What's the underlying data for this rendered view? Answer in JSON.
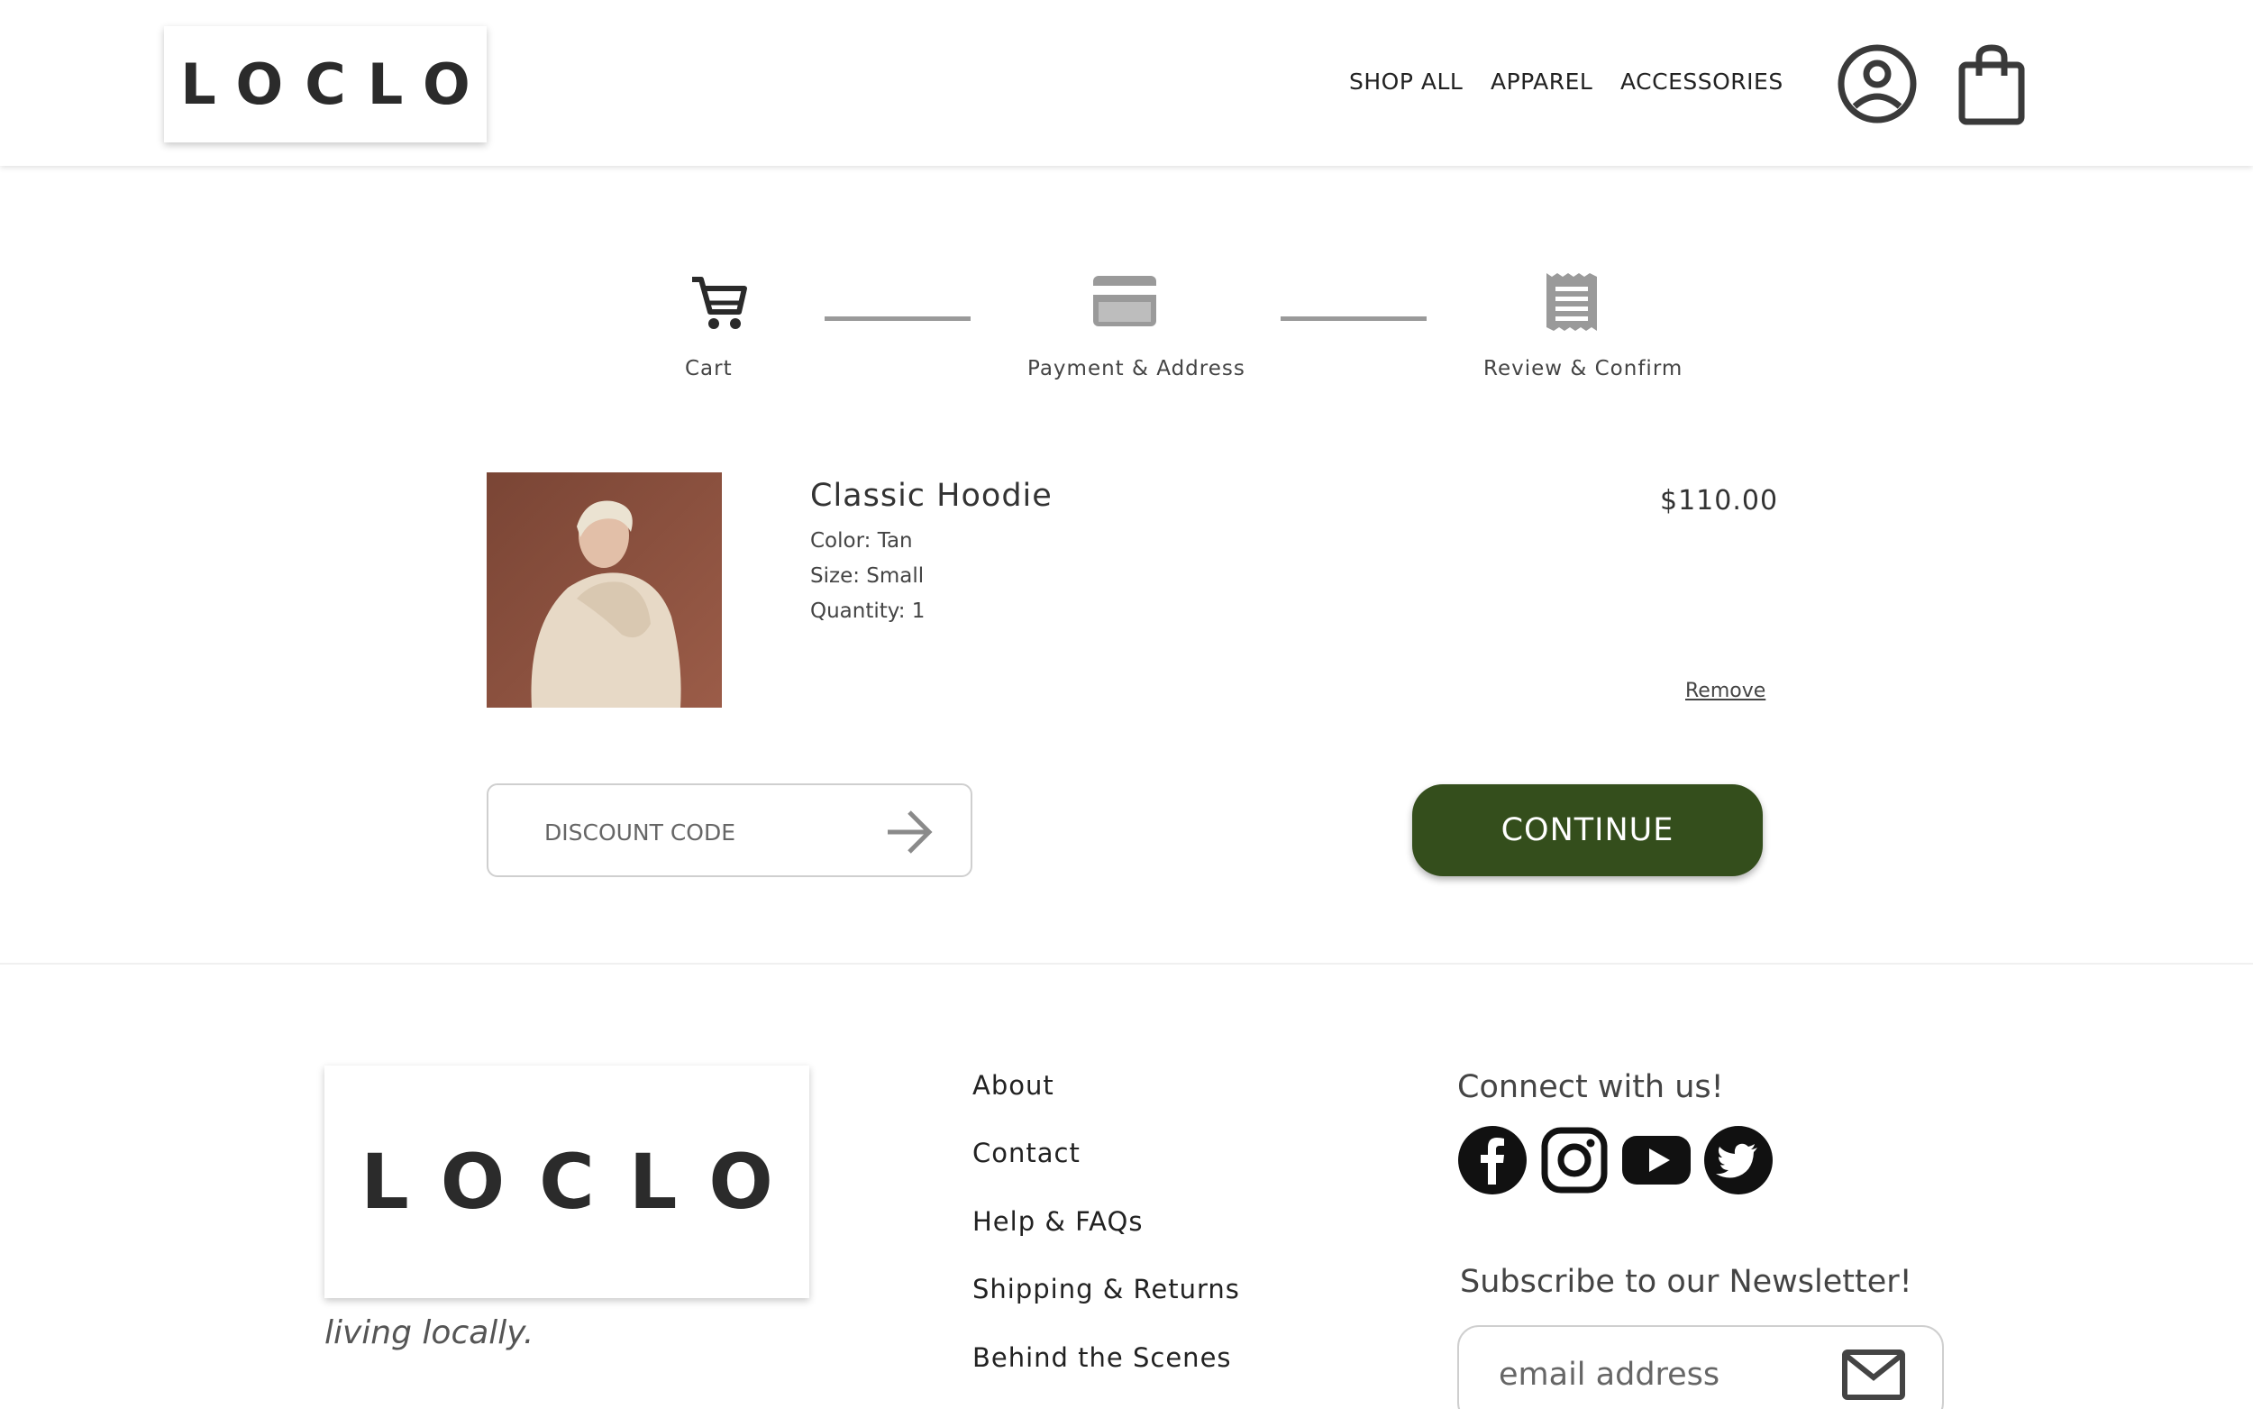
{
  "header": {
    "logo": "LOCLO",
    "nav": [
      "SHOP ALL",
      "APPAREL",
      "ACCESSORIES"
    ],
    "account_icon": "user-circle-icon",
    "bag_icon": "shopping-bag-icon"
  },
  "steps": [
    {
      "label": "Cart",
      "icon": "cart-icon",
      "state": "active"
    },
    {
      "label": "Payment & Address",
      "icon": "credit-card-icon",
      "state": "pending"
    },
    {
      "label": "Review & Confirm",
      "icon": "receipt-icon",
      "state": "pending"
    }
  ],
  "cart_item": {
    "name": "Classic Hoodie",
    "color": "Color: Tan",
    "size": "Size: Small",
    "quantity": "Quantity: 1",
    "price": "$110.00",
    "remove_label": "Remove"
  },
  "discount": {
    "placeholder": "DISCOUNT CODE"
  },
  "continue_label": "CONTINUE",
  "footer": {
    "logo": "LOCLO",
    "tagline": "living locally.",
    "links": [
      "About",
      "Contact",
      "Help & FAQs",
      "Shipping & Returns",
      "Behind the Scenes"
    ],
    "connect_title": "Connect with us!",
    "social": [
      "facebook-icon",
      "instagram-icon",
      "youtube-icon",
      "twitter-icon"
    ],
    "newsletter_title": "Subscribe to our Newsletter!",
    "email_placeholder": "email address"
  },
  "colors": {
    "accent": "#344e1c",
    "inactive_icon": "#9a9a9a",
    "product_bg": "#8a4f3f"
  }
}
